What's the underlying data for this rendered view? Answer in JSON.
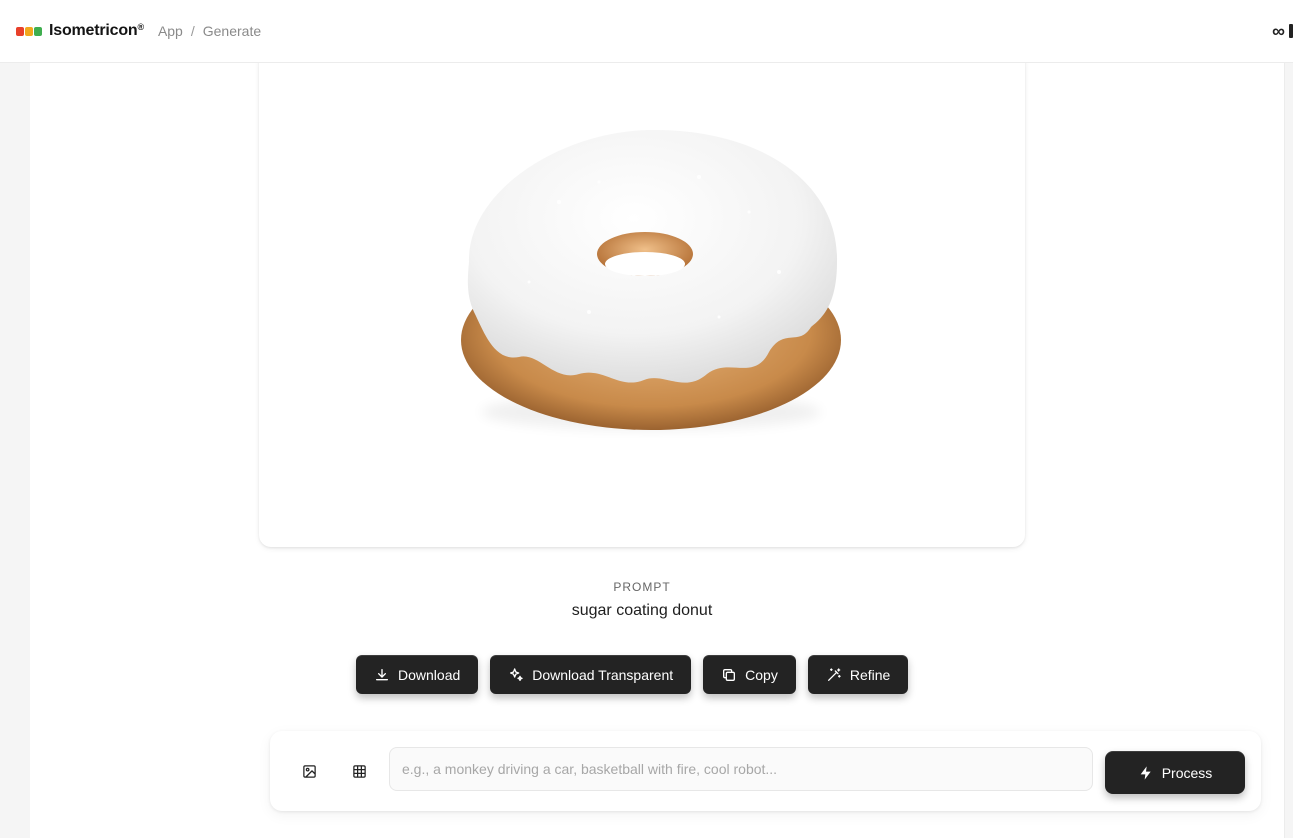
{
  "header": {
    "logo": {
      "name": "Isometricon",
      "reg_mark": "®",
      "cube_colors": [
        "#e8402a",
        "#f2a81d",
        "#3fae4f"
      ]
    },
    "breadcrumb": [
      "App",
      "Generate"
    ],
    "breadcrumb_separator": "/",
    "right_icon": "infinity-icon",
    "right_icon_glyph": "∞"
  },
  "result": {
    "image_description_icon": "donut-image",
    "prompt_label": "PROMPT",
    "prompt_text": "sugar coating donut"
  },
  "actions": [
    {
      "label": "Download",
      "icon": "download-icon"
    },
    {
      "label": "Download Transparent",
      "icon": "sparkles-icon"
    },
    {
      "label": "Copy",
      "icon": "copy-icon"
    },
    {
      "label": "Refine",
      "icon": "magic-wand-icon"
    }
  ],
  "composer": {
    "tools": [
      {
        "icon": "image-icon"
      },
      {
        "icon": "grid-icon"
      }
    ],
    "input": {
      "value": "",
      "placeholder": "e.g., a monkey driving a car, basketball with fire, cool robot..."
    },
    "submit_label": "Process",
    "submit_icon": "bolt-icon"
  },
  "colors": {
    "button_bg": "#232323",
    "page_bg": "#ffffff",
    "frosting": "#f4f4f4",
    "dough": "#c88a4a"
  }
}
